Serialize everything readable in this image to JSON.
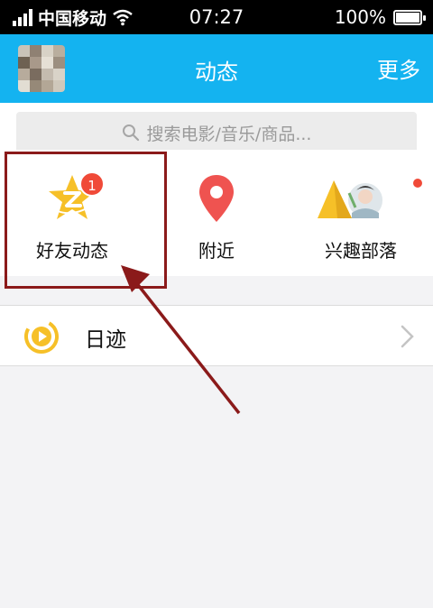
{
  "status_bar": {
    "carrier": "中国移动",
    "time": "07:27",
    "battery": "100%",
    "battery_level": 1.0
  },
  "header": {
    "title": "动态",
    "more_label": "更多"
  },
  "search": {
    "placeholder": "搜索电影/音乐/商品..."
  },
  "shortcuts": [
    {
      "label": "好友动态",
      "icon": "qzone-star-icon",
      "badge": "1"
    },
    {
      "label": "附近",
      "icon": "location-pin-icon"
    },
    {
      "label": "兴趣部落",
      "icon": "tribe-tent-icon",
      "has_dot": true
    }
  ],
  "list": [
    {
      "label": "日迹",
      "icon": "play-circle-icon"
    }
  ],
  "colors": {
    "header_bg": "#14b3f0",
    "badge_red": "#f04a38",
    "highlight": "#8b1a1a",
    "star_yellow": "#f6c028",
    "pin_red": "#ef5350"
  }
}
